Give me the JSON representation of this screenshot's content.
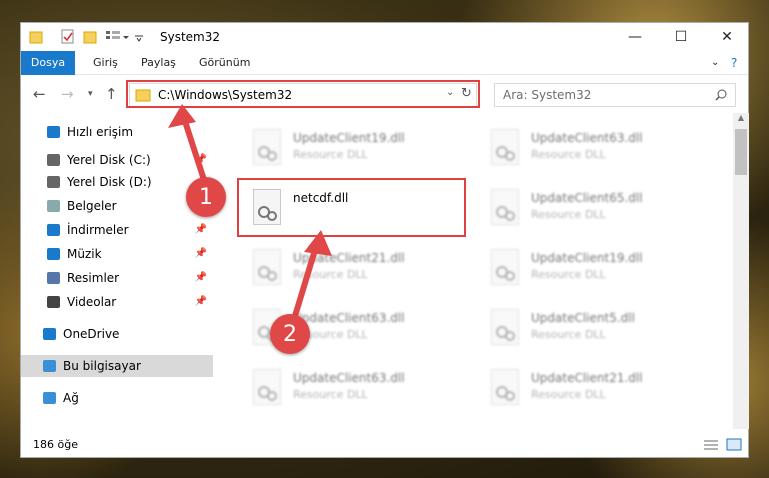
{
  "window": {
    "title": "System32"
  },
  "ribbon": {
    "tabs": [
      "Dosya",
      "Giriş",
      "Paylaş",
      "Görünüm"
    ]
  },
  "address": {
    "path": "C:\\Windows\\System32"
  },
  "search": {
    "placeholder": "Ara: System32"
  },
  "sidebar": {
    "items": [
      {
        "label": "Hızlı erişim",
        "icon": "star-icon",
        "pinned": false
      },
      {
        "label": "Yerel Disk (C:)",
        "icon": "drive-icon",
        "pinned": true
      },
      {
        "label": "Yerel Disk (D:)",
        "icon": "drive-icon",
        "pinned": false
      },
      {
        "label": "Belgeler",
        "icon": "document-icon",
        "pinned": true
      },
      {
        "label": "İndirmeler",
        "icon": "download-icon",
        "pinned": true
      },
      {
        "label": "Müzik",
        "icon": "music-icon",
        "pinned": true
      },
      {
        "label": "Resimler",
        "icon": "pictures-icon",
        "pinned": true
      },
      {
        "label": "Videolar",
        "icon": "video-icon",
        "pinned": true
      },
      {
        "label": "OneDrive",
        "icon": "cloud-icon",
        "pinned": false
      },
      {
        "label": "Bu bilgisayar",
        "icon": "computer-icon",
        "pinned": false
      },
      {
        "label": "Ağ",
        "icon": "network-icon",
        "pinned": false
      }
    ]
  },
  "files": {
    "left": [
      {
        "name": "UpdateClient19.dll",
        "type": "Resource DLL"
      },
      {
        "name": "netcdf.dll",
        "type": ""
      },
      {
        "name": "UpdateClient21.dll",
        "type": "Resource DLL"
      },
      {
        "name": "UpdateClient63.dll",
        "type": "Resource DLL"
      },
      {
        "name": "UpdateClient63.dll",
        "type": "Resource DLL"
      }
    ],
    "right": [
      {
        "name": "UpdateClient63.dll",
        "type": "Resource DLL"
      },
      {
        "name": "UpdateClient65.dll",
        "type": "Resource DLL"
      },
      {
        "name": "UpdateClient19.dll",
        "type": "Resource DLL"
      },
      {
        "name": "UpdateClient5.dll",
        "type": "Resource DLL"
      },
      {
        "name": "UpdateClient21.dll",
        "type": "Resource DLL"
      }
    ]
  },
  "status": {
    "count": "186 öğe"
  },
  "callouts": {
    "one": "1",
    "two": "2"
  },
  "colors": {
    "accent": "#1979ca",
    "callout": "#e04848",
    "highlight": "#e04040"
  }
}
